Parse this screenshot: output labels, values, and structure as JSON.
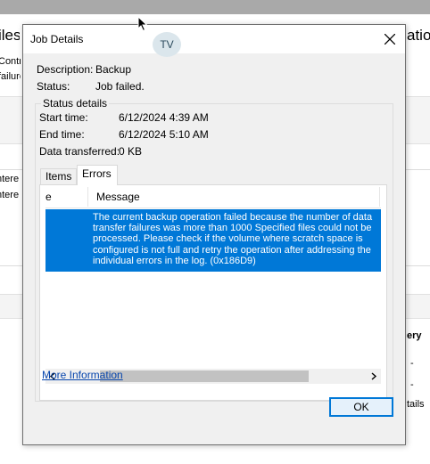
{
  "background": {
    "title_left": "iles",
    "title_right": "atio",
    "left_lines": [
      "Contr",
      "failure",
      "ntered",
      "ntered"
    ],
    "right_heading": "ery",
    "right_values": [
      "-",
      "-",
      "tails"
    ]
  },
  "dialog": {
    "title": "Job Details",
    "avatar_initials": "TV",
    "description_label": "Description:",
    "description_value": "Backup",
    "status_label": "Status:",
    "status_value": "Job failed.",
    "status_details_title": "Status details",
    "start_time_label": "Start time:",
    "start_time_value": "6/12/2024 4:39 AM",
    "end_time_label": "End time:",
    "end_time_value": "6/12/2024 5:10 AM",
    "data_transferred_label": "Data transferred:",
    "data_transferred_value": "0 KB",
    "tabs": [
      {
        "label": "Items",
        "selected": false
      },
      {
        "label": "Errors",
        "selected": true
      }
    ],
    "columns": [
      "e",
      "Message"
    ],
    "rows": [
      {
        "message": "The current backup operation failed because the number of data transfer failures was more than 1000 Specified files could not be processed. Please check if the volume where scratch space is configured is not full and retry the operation after addressing the individual errors in the log. (0x186D9)"
      }
    ],
    "more_info_label": "More Information",
    "ok_label": "OK"
  },
  "colors": {
    "selection": "#0078d7",
    "link": "#0645ad",
    "dialog_bg": "#f0f0f0"
  }
}
